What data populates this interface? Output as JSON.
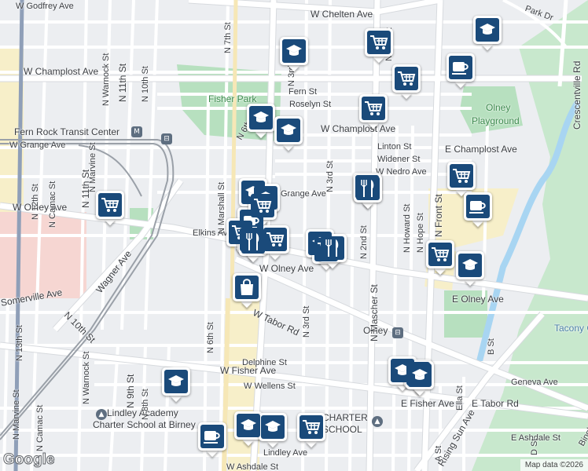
{
  "map": {
    "colors": {
      "background": "#eceef1",
      "road": "#ffffff",
      "road_casing": "#d7dade",
      "arterial": "#f6e7b6",
      "rail": "#9aa0a8",
      "park": "#b7e0bf",
      "water": "#a8d5f2",
      "landuse_red": "#f6d6d2",
      "landuse_yellow": "#f7efc9",
      "pin_fill": "#1a4a7a",
      "pin_border": "#ffffff"
    },
    "street_labels": [
      {
        "text": "W Godfrey Ave",
        "name": "label-w-godfrey-ave-west"
      },
      {
        "text": "W Chelten Ave",
        "name": "label-w-chelten-ave"
      },
      {
        "text": "Park Dr",
        "name": "label-park-dr"
      },
      {
        "text": "Crescentville Rd",
        "name": "label-crescentville-rd"
      },
      {
        "text": "W Champlost Ave",
        "name": "label-w-champlost-ave-west"
      },
      {
        "text": "Fern St",
        "name": "label-fern-st"
      },
      {
        "text": "Roselyn St",
        "name": "label-roselyn-st"
      },
      {
        "text": "Fisher Park",
        "name": "label-fisher-park"
      },
      {
        "text": "W Champlost Ave",
        "name": "label-w-champlost-ave-east"
      },
      {
        "text": "Olney",
        "name": "label-olney-area"
      },
      {
        "text": "Playground",
        "name": "label-playground"
      },
      {
        "text": "Fern Rock Transit Center",
        "name": "label-fern-rock-transit-center"
      },
      {
        "text": "W Grange Ave",
        "name": "label-w-grange-ave-west"
      },
      {
        "text": "Linton St",
        "name": "label-linton-st"
      },
      {
        "text": "E Champlost Ave",
        "name": "label-e-champlost-ave"
      },
      {
        "text": "Widener St",
        "name": "label-widener-st"
      },
      {
        "text": "W Nedro Ave",
        "name": "label-w-nedro-ave"
      },
      {
        "text": "Grange Ave",
        "name": "label-grange-ave-east"
      },
      {
        "text": "W Olney Ave",
        "name": "label-w-olney-ave-west"
      },
      {
        "text": "Elkins Ave",
        "name": "label-elkins-ave"
      },
      {
        "text": "W Olney Ave",
        "name": "label-w-olney-ave-east"
      },
      {
        "text": "Wagner Ave",
        "name": "label-wagner-ave"
      },
      {
        "text": "Somerville Ave",
        "name": "label-somerville-ave"
      },
      {
        "text": "E Olney Ave",
        "name": "label-e-olney-ave"
      },
      {
        "text": "W Tabor Rd",
        "name": "label-w-tabor-rd"
      },
      {
        "text": "Olney",
        "name": "label-olney-station"
      },
      {
        "text": "Tacony Creek Park",
        "name": "label-tacony-creek-park"
      },
      {
        "text": "N 10th St",
        "name": "label-n-10th-st-diag"
      },
      {
        "text": "Delphine St",
        "name": "label-delphine-st"
      },
      {
        "text": "W Fisher Ave",
        "name": "label-w-fisher-ave"
      },
      {
        "text": "W Wellens St",
        "name": "label-w-wellens-st"
      },
      {
        "text": "Geneva Ave",
        "name": "label-geneva-ave"
      },
      {
        "text": "E Fisher Ave",
        "name": "label-e-fisher-ave"
      },
      {
        "text": "E Tabor Rd",
        "name": "label-e-tabor-rd"
      },
      {
        "text": "Lindley Academy",
        "name": "label-lindley-academy-1"
      },
      {
        "text": "Charter School at Birney",
        "name": "label-lindley-academy-2"
      },
      {
        "text": "CHARTER",
        "name": "label-charter"
      },
      {
        "text": "SCHOOL",
        "name": "label-school"
      },
      {
        "text": "E Ashdale St",
        "name": "label-e-ashdale-st"
      },
      {
        "text": "Lindley Ave",
        "name": "label-lindley-ave"
      },
      {
        "text": "W Ashdale St",
        "name": "label-w-ashdale-st"
      },
      {
        "text": "Rising Sun Ave",
        "name": "label-rising-sun-ave"
      },
      {
        "text": "N 11th St",
        "name": "label-n-11th-st-top"
      },
      {
        "text": "N Warnock St",
        "name": "label-n-warnock-st-top"
      },
      {
        "text": "N 10th St",
        "name": "label-n-10th-st-top"
      },
      {
        "text": "N Marvine St",
        "name": "label-n-marvine-st-top"
      },
      {
        "text": "N 11th St",
        "name": "label-n-11th-st-mid"
      },
      {
        "text": "N Camac St",
        "name": "label-n-camac-st-mid"
      },
      {
        "text": "N 12th St",
        "name": "label-n-12th-st"
      },
      {
        "text": "N Marshall St",
        "name": "label-n-marshall-st"
      },
      {
        "text": "N 6th St",
        "name": "label-n-6th-st-top"
      },
      {
        "text": "N 6th St",
        "name": "label-n-6th-st-bottom"
      },
      {
        "text": "N 3rd St",
        "name": "label-n-3rd-st-top"
      },
      {
        "text": "N 3rd St",
        "name": "label-n-3rd-st-mid"
      },
      {
        "text": "N 3rd St",
        "name": "label-n-3rd-st-bottom"
      },
      {
        "text": "N 2nd St",
        "name": "label-n-2nd-st"
      },
      {
        "text": "N Howard St",
        "name": "label-n-howard-st"
      },
      {
        "text": "N Hope St",
        "name": "label-n-hope-st"
      },
      {
        "text": "N Front St",
        "name": "label-n-front-st"
      },
      {
        "text": "N Mascher St",
        "name": "label-n-mascher-st"
      },
      {
        "text": "A St",
        "name": "label-a-st"
      },
      {
        "text": "B St",
        "name": "label-b-st"
      },
      {
        "text": "Ella St",
        "name": "label-ella-st"
      },
      {
        "text": "N 13th St",
        "name": "label-n-13th-st"
      },
      {
        "text": "N Warnock St",
        "name": "label-n-warnock-st-bottom"
      },
      {
        "text": "N 9th St",
        "name": "label-n-9th-st"
      },
      {
        "text": "N 8th St",
        "name": "label-n-8th-st"
      },
      {
        "text": "N Marvine St",
        "name": "label-n-marvine-st-bottom"
      },
      {
        "text": "N Camac St",
        "name": "label-n-camac-st-bottom"
      },
      {
        "text": "D St",
        "name": "label-d-st"
      },
      {
        "text": "Bingham St",
        "name": "label-bingham-st"
      },
      {
        "text": "N 7th St",
        "name": "label-n-7th-st"
      },
      {
        "text": "N 2nd St",
        "name": "label-n-2nd-st-top"
      }
    ],
    "markers": [
      {
        "type": "school",
        "name": "marker-school"
      },
      {
        "type": "coffee",
        "name": "marker-coffee"
      },
      {
        "type": "grocery",
        "name": "marker-grocery"
      },
      {
        "type": "grocery",
        "name": "marker-grocery"
      },
      {
        "type": "school",
        "name": "marker-school"
      },
      {
        "type": "grocery",
        "name": "marker-grocery"
      },
      {
        "type": "school",
        "name": "marker-school"
      },
      {
        "type": "school",
        "name": "marker-school"
      },
      {
        "type": "grocery",
        "name": "marker-grocery"
      },
      {
        "type": "grocery",
        "name": "marker-grocery"
      },
      {
        "type": "restaurant",
        "name": "marker-restaurant"
      },
      {
        "type": "grocery",
        "name": "marker-grocery"
      },
      {
        "type": "coffee",
        "name": "marker-coffee"
      },
      {
        "type": "school",
        "name": "marker-school"
      },
      {
        "type": "school",
        "name": "marker-school"
      },
      {
        "type": "shopping",
        "name": "marker-shopping"
      },
      {
        "type": "grocery",
        "name": "marker-grocery"
      },
      {
        "type": "school",
        "name": "marker-school"
      },
      {
        "type": "school",
        "name": "marker-school"
      },
      {
        "type": "grocery",
        "name": "marker-grocery"
      },
      {
        "type": "coffee",
        "name": "marker-coffee"
      },
      {
        "type": "grocery",
        "name": "marker-grocery"
      },
      {
        "type": "restaurant",
        "name": "marker-restaurant"
      },
      {
        "type": "restaurant",
        "name": "marker-restaurant"
      },
      {
        "type": "restaurant",
        "name": "marker-restaurant"
      },
      {
        "type": "grocery",
        "name": "marker-grocery"
      },
      {
        "type": "school",
        "name": "marker-school"
      },
      {
        "type": "school",
        "name": "marker-school"
      }
    ],
    "transit_icon_glyph": "M",
    "bus_icon_glyph": "⊟",
    "school_poi_glyph": "▲",
    "logo_text": "Google",
    "attribution": "Map data ©2026"
  }
}
